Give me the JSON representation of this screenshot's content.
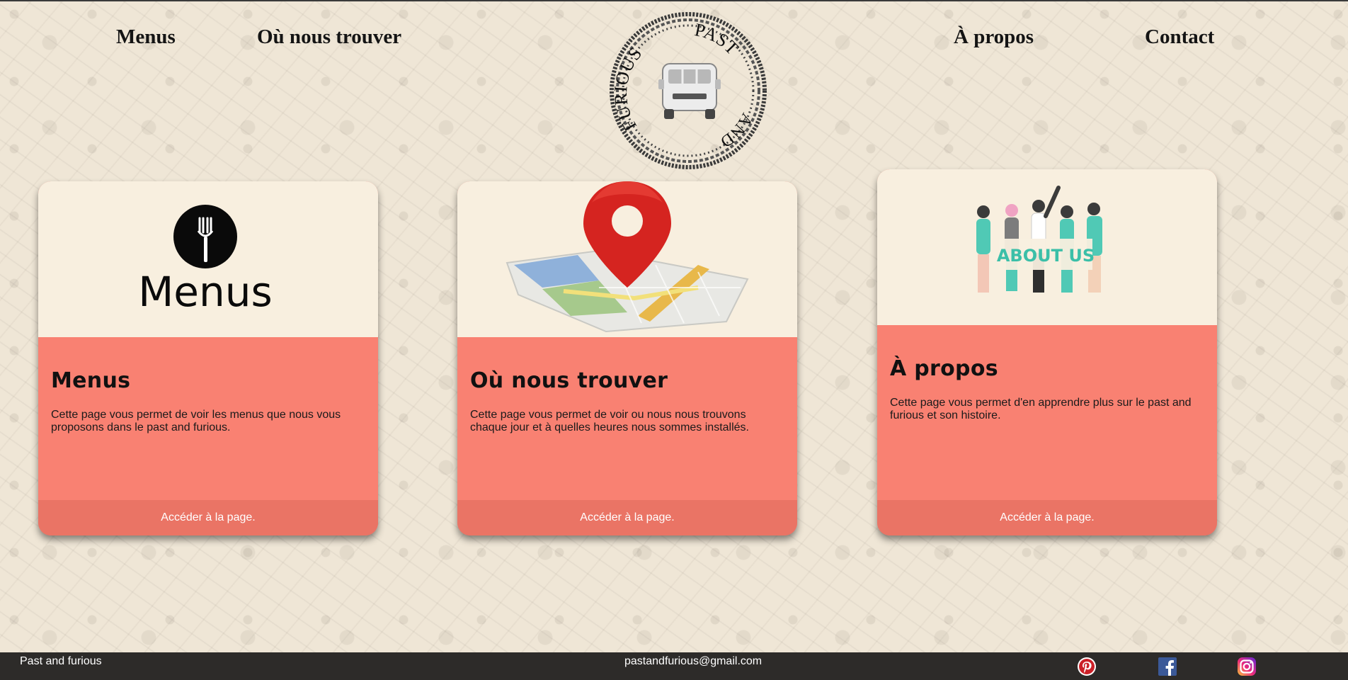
{
  "nav": {
    "menus": "Menus",
    "trouver": "Où nous trouver",
    "apropos": "À propos",
    "contact": "Contact"
  },
  "logo": {
    "text_top": "PAST",
    "text_left": "FURIOUS",
    "text_bottom": "AND",
    "icon": "food-truck-icon"
  },
  "cards": [
    {
      "image_icon": "fork-icon",
      "image_caption": "Menus",
      "title": "Menus",
      "text": "Cette page vous permet de voir les menus que nous vous proposons dans le past and furious.",
      "link": "Accéder à la page."
    },
    {
      "image_icon": "map-pin-icon",
      "title": "Où nous trouver",
      "text": "Cette page vous permet de voir ou nous nous trouvons chaque jour et à quelles heures nous sommes installés.",
      "link": "Accéder à la page."
    },
    {
      "image_icon": "about-us-people-icon",
      "image_caption": "ABOUT US",
      "title": "À propos",
      "text": "Cette page vous permet d'en apprendre plus sur le past and furious et son histoire.",
      "link": "Accéder à la page."
    }
  ],
  "footer": {
    "brand": "Past and furious",
    "email": "pastandfurious@gmail.com",
    "social": [
      "pinterest-icon",
      "facebook-icon",
      "instagram-icon"
    ]
  },
  "colors": {
    "background": "#efe6d6",
    "card_top": "#f8efdf",
    "card_body": "#f98172",
    "card_footer": "#ea7465",
    "footer_bar": "#2d2b29"
  }
}
